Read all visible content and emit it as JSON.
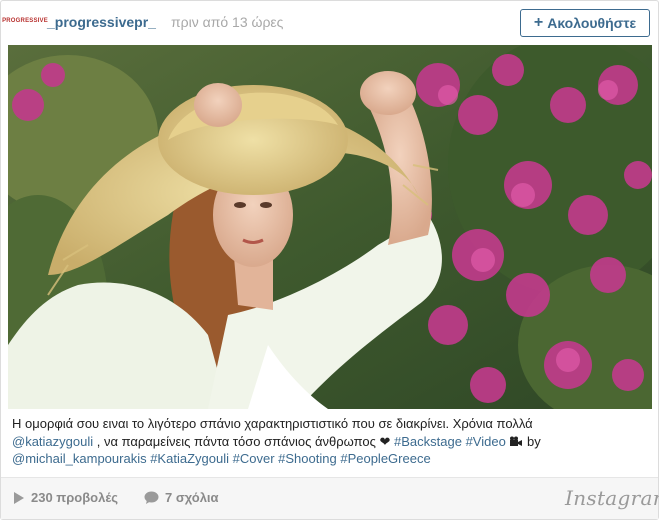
{
  "header": {
    "avatar_text": "PROGRESSIVE",
    "username": "_progressivepr_",
    "timestamp": "πριν από 13 ώρες",
    "follow_label": "Ακολουθήστε"
  },
  "caption": {
    "line1": "Η ομορφιά σου ειναι το λιγότερο σπάνιο χαρακτηριστιστικό που σε διακρίνει. Χρόνια πολλά",
    "mention1": "@katiazygouli",
    "line2_text": " , να παραμείνεις πάντα τόσο σπάνιος άνθρωπος ",
    "heart": "❤",
    "space": " ",
    "tag_backstage": "#Backstage",
    "tag_video": "#Video",
    "by_text": " by",
    "mention2": "@michail_kampourakis",
    "tag_katia": "#KatiaZygouli",
    "tag_cover": "#Cover",
    "tag_shooting": "#Shooting",
    "tag_peoplegreece": "#PeopleGreece"
  },
  "footer": {
    "views_label": "230 προβολές",
    "comments_label": "7 σχόλια",
    "brand": "Instagram"
  },
  "colors": {
    "link": "#3d6b8f",
    "muted": "#a8a8a8"
  }
}
